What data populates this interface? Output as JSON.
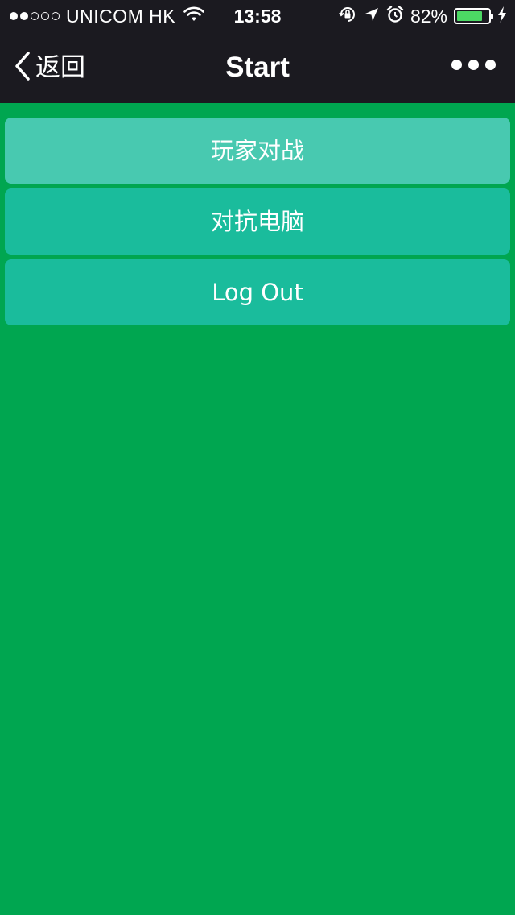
{
  "status_bar": {
    "carrier": "UNICOM HK",
    "time": "13:58",
    "battery_percent": "82%",
    "battery_level": 0.82,
    "signal_bars_filled": 2,
    "signal_bars_total": 5,
    "icons": [
      "wifi-icon",
      "orientation-lock-icon",
      "location-arrow-icon",
      "alarm-icon",
      "battery-icon",
      "charging-bolt-icon"
    ]
  },
  "nav": {
    "back_label": "返回",
    "title": "Start",
    "back_icon": "chevron-left-icon",
    "more_icon": "more-dots-icon"
  },
  "menu": {
    "items": [
      {
        "label": "玩家对战",
        "state": "pressed"
      },
      {
        "label": "对抗电脑",
        "state": "normal"
      },
      {
        "label": "Log Out",
        "state": "normal"
      }
    ]
  },
  "colors": {
    "background": "#00a650",
    "header": "#1b1a20",
    "button": "#1abc9c",
    "button_pressed": "#48c9b0",
    "battery": "#4cd964"
  }
}
